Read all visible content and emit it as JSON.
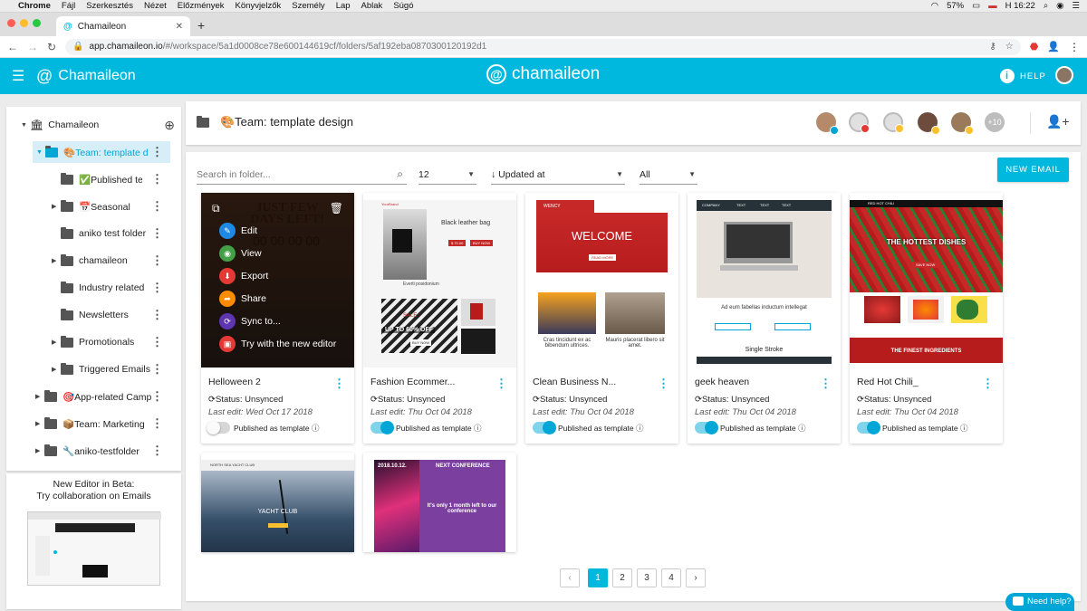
{
  "mac_menu": {
    "apple": "",
    "app": "Chrome",
    "items": [
      "Fájl",
      "Szerkesztés",
      "Nézet",
      "Előzmények",
      "Könyvjelzők",
      "Személy",
      "Lap",
      "Ablak",
      "Súgó"
    ],
    "battery": "57%",
    "time": "H 16:22"
  },
  "browser": {
    "tab_title": "Chamaileon",
    "url_host": "app.chamaileon.io",
    "url_path": "/#/workspace/5a1d0008ce78e600144619cf/folders/5af192eba0870300120192d1"
  },
  "appbar": {
    "brand_left": "Chamaileon",
    "brand_center": "chamaileon",
    "help": "HELP"
  },
  "sidebar": {
    "root": "Chamaileon",
    "items": [
      {
        "label": "🎨Team: template d",
        "level": 1,
        "expanded": true,
        "selected": true
      },
      {
        "label": "✅Published tem",
        "level": 2
      },
      {
        "label": "📅Seasonal",
        "level": 2,
        "expandable": true
      },
      {
        "label": "aniko test folder",
        "level": 2
      },
      {
        "label": "chamaileon",
        "level": 2,
        "expandable": true
      },
      {
        "label": "Industry related",
        "level": 2
      },
      {
        "label": "Newsletters",
        "level": 2
      },
      {
        "label": "Promotionals",
        "level": 2,
        "expandable": true
      },
      {
        "label": "Triggered Emails",
        "level": 2,
        "expandable": true
      },
      {
        "label": "🎯App-related Camp",
        "level": 1,
        "expandable": true
      },
      {
        "label": "📦Team: Marketing",
        "level": 1,
        "expandable": true
      },
      {
        "label": "🔧aniko-testfolder",
        "level": 1,
        "expandable": true
      }
    ],
    "beta_line1": "New Editor in Beta:",
    "beta_line2": "Try collaboration on Emails"
  },
  "header": {
    "title": "🎨Team: template design",
    "more_users": "+10"
  },
  "filters": {
    "search_placeholder": "Search in folder...",
    "page_size": "12",
    "sort": "Updated at",
    "filter": "All"
  },
  "new_email_button": "NEW EMAIL",
  "overlay_menu": {
    "items": [
      "Edit",
      "View",
      "Export",
      "Share",
      "Sync to...",
      "Try with the new editor"
    ],
    "colors": [
      "#1e88e5",
      "#43a047",
      "#e53935",
      "#fb8c00",
      "#5e35b1",
      "#e53935"
    ]
  },
  "cards": [
    {
      "name": "Helloween 2",
      "status": "Status: Unsynced",
      "last_edit": "Last edit: Wed Oct 17 2018",
      "published_label": "Published as template",
      "published": false,
      "thumb_text": [
        "JUST FEW",
        "DAYS LEFT!",
        "00 00 00 00"
      ]
    },
    {
      "name": "Fashion Ecommer...",
      "status": "Status: Unsynced",
      "last_edit": "Last edit: Thu Oct 04 2018",
      "published_label": "Published as template",
      "published": true,
      "thumb_text": [
        "YourBrand",
        "Black leather bag",
        "$ 70.00",
        "BUY NOW",
        "Everti posidonium",
        "SALE",
        "UP TO 60% OFF",
        "BUY NOW"
      ]
    },
    {
      "name": "Clean Business N...",
      "status": "Status: Unsynced",
      "last_edit": "Last edit: Thu Oct 04 2018",
      "published_label": "Published as template",
      "published": true,
      "thumb_text": [
        "WENCY",
        "WELCOME",
        "READ MORE",
        "Cras tincidunt ex ac bibendum ultrices.",
        "Mauris placerat libero sit amet."
      ]
    },
    {
      "name": "geek heaven",
      "status": "Status: Unsynced",
      "last_edit": "Last edit: Thu Oct 04 2018",
      "published_label": "Published as template",
      "published": true,
      "thumb_text": [
        "COMPANY",
        "TEXT",
        "TEXT",
        "TEXT",
        "Ad eum fabellas inductum intellegat",
        "Single Stroke"
      ]
    },
    {
      "name": "Red Hot Chili_",
      "status": "Status: Unsynced",
      "last_edit": "Last edit: Thu Oct 04 2018",
      "published_label": "Published as template",
      "published": true,
      "thumb_text": [
        "RED HOT CHILI",
        "THE HOTTEST DISHES",
        "SAVE NOW",
        "THE FINEST INGREDIENTS"
      ]
    },
    {
      "name": "",
      "thumb_text": [
        "NORTH SEA YACHT CLUB",
        "YACHT CLUB"
      ]
    },
    {
      "name": "",
      "thumb_text": [
        "2018.10.12.",
        "NEXT CONFERENCE",
        "It's only 1 month left to our conference"
      ]
    }
  ],
  "pagination": {
    "pages": [
      "1",
      "2",
      "3",
      "4"
    ],
    "current": "1",
    "prev": "‹",
    "next": "›"
  },
  "need_help": "Need help?"
}
